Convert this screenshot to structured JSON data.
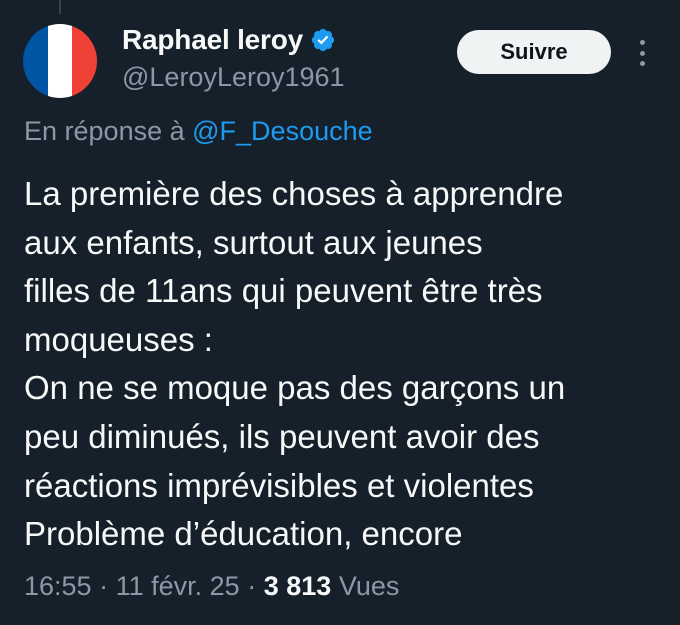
{
  "author": {
    "display_name": "Raphael leroy",
    "handle": "@LeroyLeroy1961",
    "verified": true,
    "avatar_icon": "french-flag-icon",
    "avatar_colors": [
      "#0055a4",
      "#ffffff",
      "#ef4135"
    ]
  },
  "actions": {
    "follow_label": "Suivre",
    "more_icon": "more-vertical-icon"
  },
  "reply": {
    "prefix": "En réponse à",
    "mention": "@F_Desouche"
  },
  "tweet": {
    "text": "La première des choses à apprendre\naux enfants, surtout aux jeunes\nfilles de 11ans qui peuvent être très\nmoqueuses :\nOn ne se moque pas des garçons un\npeu diminués, ils peuvent avoir des\nréactions imprévisibles et violentes\nProblème d’éducation, encore"
  },
  "meta": {
    "time": "16:55",
    "separator": "·",
    "date": "11 févr. 25",
    "views_count": "3 813",
    "views_label": "Vues"
  },
  "colors": {
    "background": "#15202b",
    "text_primary": "#f7f9f9",
    "text_secondary": "#8b98a5",
    "accent": "#1d9bf0",
    "button_bg": "#eff3f4"
  }
}
